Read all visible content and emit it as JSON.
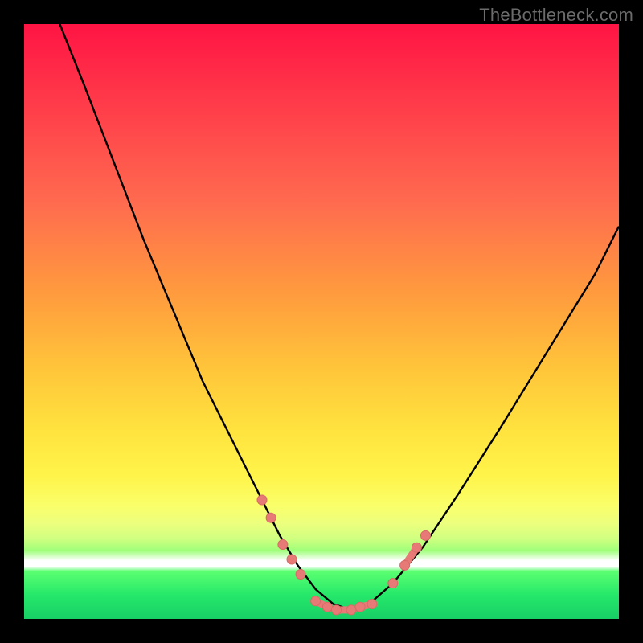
{
  "watermark": "TheBottleneck.com",
  "colors": {
    "curve": "#000000",
    "marker": "#e77a77",
    "gradient_top": "#ff1444",
    "gradient_bottom": "#18cf66"
  },
  "chart_data": {
    "type": "line",
    "title": "",
    "xlabel": "",
    "ylabel": "",
    "xlim": [
      0,
      100
    ],
    "ylim": [
      0,
      100
    ],
    "note": "Axes are unlabeled in the source image; values are normalized 0–100 by position.",
    "series": [
      {
        "name": "curve",
        "x": [
          6,
          10,
          15,
          20,
          25,
          30,
          35,
          40,
          43,
          46,
          49,
          52,
          55,
          58,
          62,
          67,
          73,
          80,
          88,
          96,
          100
        ],
        "y": [
          100,
          90,
          77,
          64,
          52,
          40,
          30,
          20,
          14,
          9,
          5,
          2.5,
          1.5,
          2.5,
          6,
          12,
          21,
          32,
          45,
          58,
          66
        ]
      }
    ],
    "markers": {
      "name": "highlighted-points",
      "description": "Salmon-colored markers near the valley of the curve",
      "points": [
        {
          "x": 40,
          "y": 20
        },
        {
          "x": 41.5,
          "y": 17
        },
        {
          "x": 43.5,
          "y": 12.5
        },
        {
          "x": 45,
          "y": 10
        },
        {
          "x": 46.5,
          "y": 7.5
        },
        {
          "x": 49,
          "y": 3,
          "dash_to": {
            "x": 51,
            "y": 2
          }
        },
        {
          "x": 52.5,
          "y": 1.5,
          "dash_to": {
            "x": 55,
            "y": 1.5
          }
        },
        {
          "x": 56.5,
          "y": 2,
          "dash_to": {
            "x": 58.5,
            "y": 2.5
          }
        },
        {
          "x": 62,
          "y": 6
        },
        {
          "x": 64,
          "y": 9,
          "dash_to": {
            "x": 66,
            "y": 12
          }
        },
        {
          "x": 67.5,
          "y": 14
        }
      ]
    }
  }
}
